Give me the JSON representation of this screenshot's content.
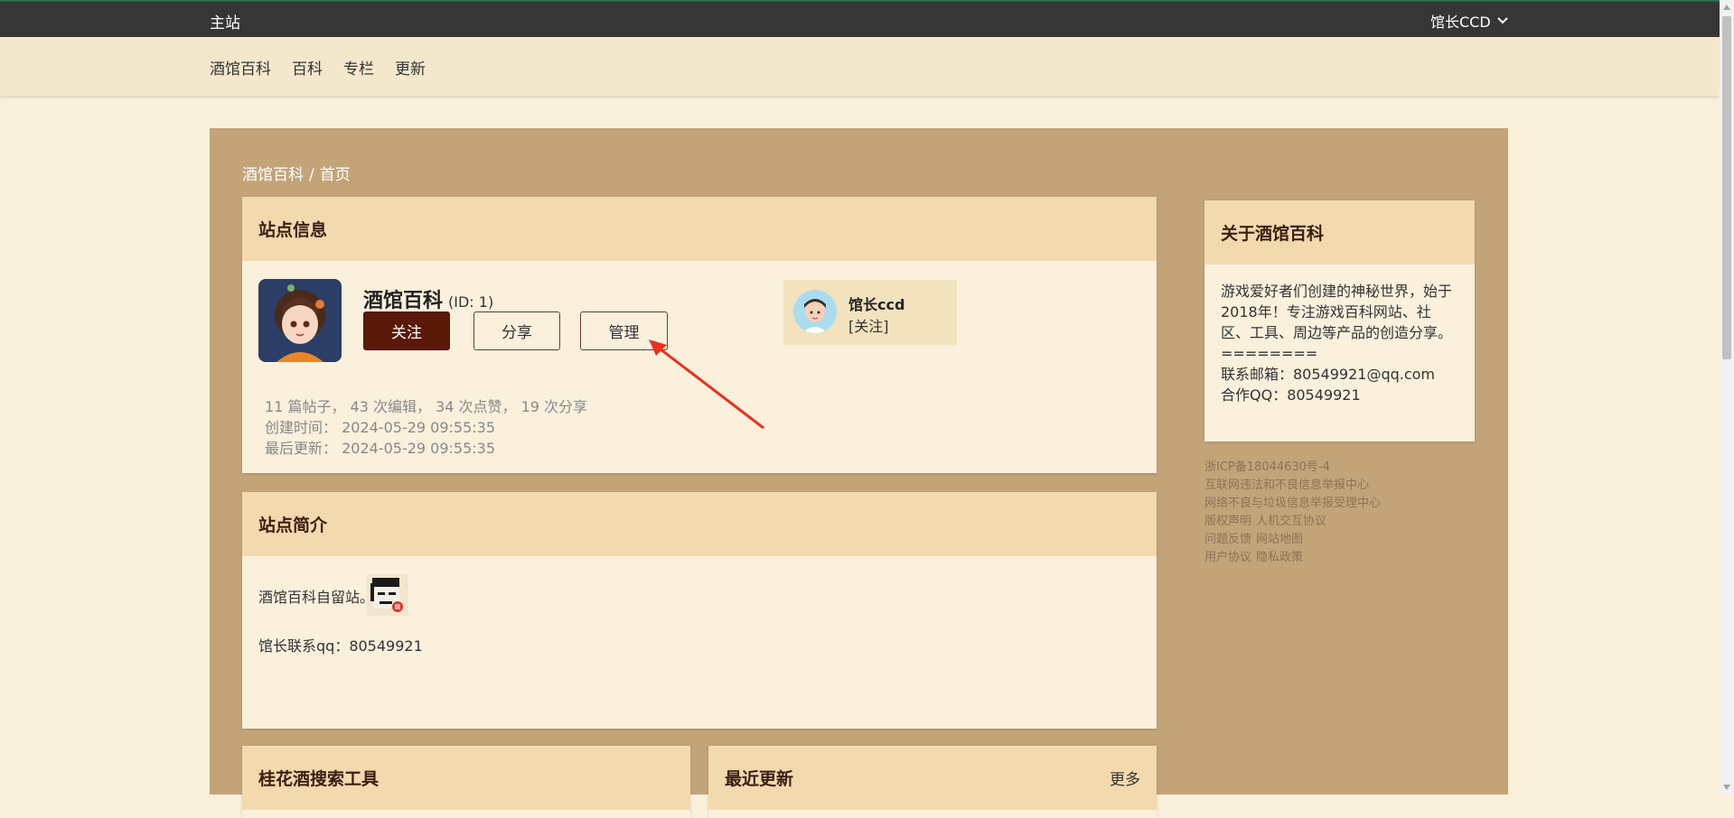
{
  "topbar": {
    "home": "主站",
    "user": "馆长CCD"
  },
  "subnav": [
    "酒馆百科",
    "百科",
    "专栏",
    "更新"
  ],
  "breadcrumb": {
    "root": "酒馆百科",
    "sep": "/",
    "current": "首页"
  },
  "site_info": {
    "title": "站点信息",
    "name": "酒馆百科",
    "id_label": "(ID: 1)",
    "buttons": {
      "follow": "关注",
      "share": "分享",
      "manage": "管理"
    },
    "owner": {
      "name": "馆长ccd",
      "follow": "[关注]"
    },
    "stats": "11 篇帖子， 43 次编辑， 34 次点赞， 19 次分享",
    "created": "创建时间： 2024-05-29 09:55:35",
    "updated": "最后更新： 2024-05-29 09:55:35"
  },
  "intro": {
    "title": "站点简介",
    "line1": "酒馆百科自留站。",
    "line2": "馆长联系qq：80549921"
  },
  "tools": {
    "title": "桂花酒搜索工具"
  },
  "recent": {
    "title": "最近更新",
    "more": "更多"
  },
  "about": {
    "title": "关于酒馆百科",
    "desc": "游戏爱好者们创建的神秘世界，始于2018年！专注游戏百科网站、社区、工具、周边等产品的创造分享。",
    "divider": "========",
    "email": "联系邮箱：80549921@qq.com",
    "qq": "合作QQ：80549921"
  },
  "footer": {
    "icp": "浙ICP备18044630号-4",
    "report1": "互联网违法和不良信息举报中心",
    "report2": "网络不良与垃圾信息举报受理中心",
    "copyright": "版权声明",
    "hci": "人机交互协议",
    "feedback": "问题反馈",
    "sitemap": "网站地图",
    "agreement": "用户协议",
    "privacy": "隐私政策"
  },
  "colors": {
    "accent": "#5a1808",
    "main_bg": "#c3a479",
    "card_head": "#f2d9ae",
    "arrow": "#e8321e"
  }
}
